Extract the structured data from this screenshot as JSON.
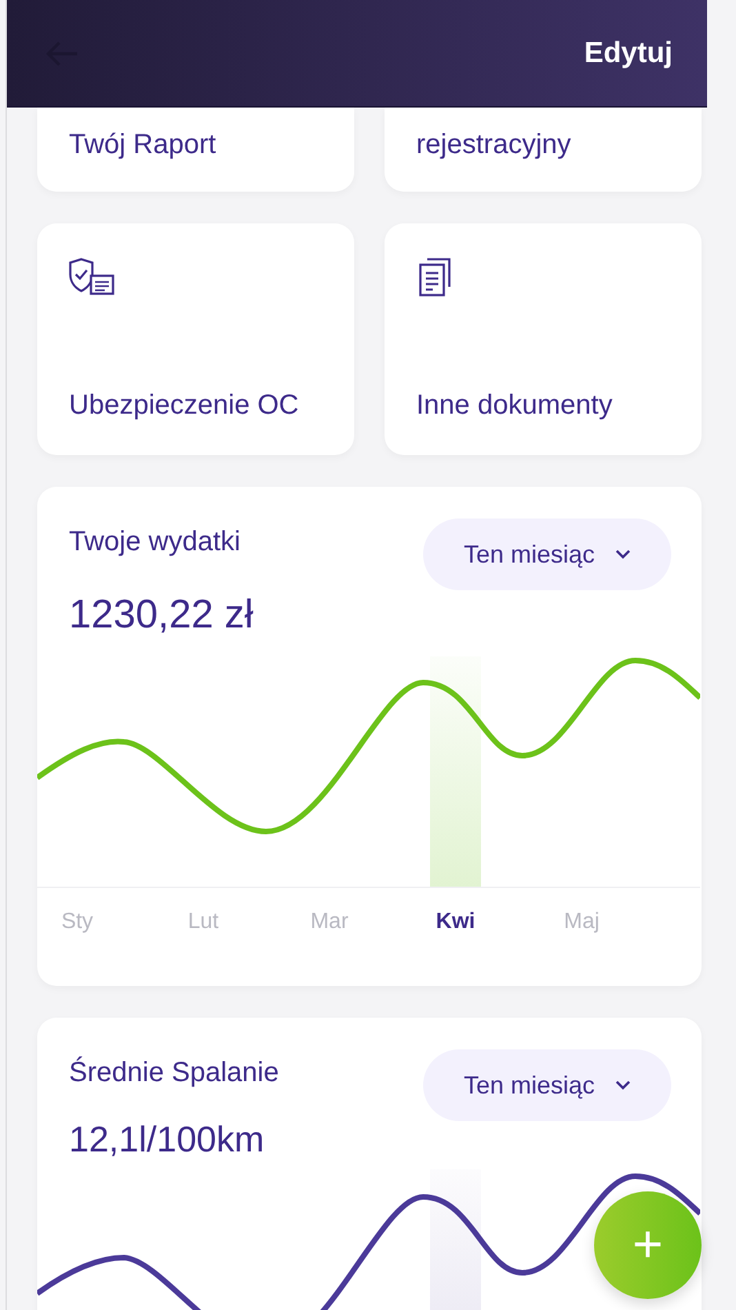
{
  "header": {
    "action": "Edytuj"
  },
  "tiles": [
    {
      "label": "Twój Raport",
      "kind": "partial"
    },
    {
      "label": "rejestracyjny",
      "kind": "partial"
    },
    {
      "label": "Ubezpieczenie OC",
      "kind": "shield"
    },
    {
      "label": "Inne dokumenty",
      "kind": "documents"
    }
  ],
  "expenses": {
    "title": "Twoje wydatki",
    "period": "Ten miesiąc",
    "amount": "1230,22 zł",
    "months": [
      {
        "label": "Sty",
        "selected": false
      },
      {
        "label": "Lut",
        "selected": false
      },
      {
        "label": "Mar",
        "selected": false
      },
      {
        "label": "Kwi",
        "selected": true
      },
      {
        "label": "Maj",
        "selected": false
      }
    ]
  },
  "consumption": {
    "title": "Średnie Spalanie",
    "period": "Ten miesiąc",
    "amount": "12,1l/100km"
  },
  "fab": {
    "label": "+"
  }
}
